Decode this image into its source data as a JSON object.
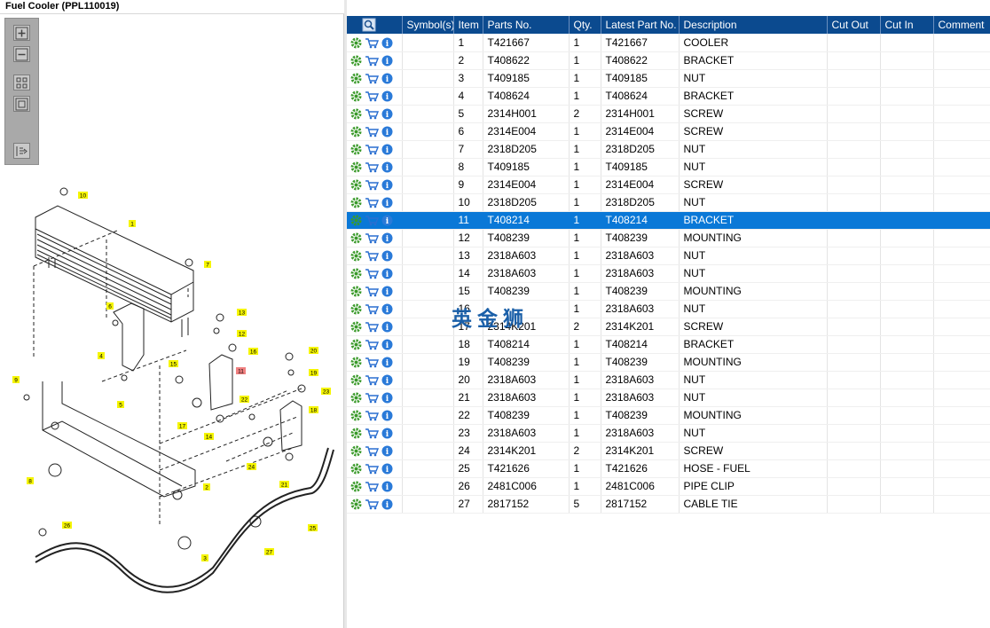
{
  "title": "Fuel Cooler (PPL110019)",
  "watermark": "英金狮",
  "toolbar": {
    "zoom_in": "zoom-in-icon",
    "zoom_out": "zoom-out-icon",
    "fit_all": "fit-all-icon",
    "fit_selection": "fit-selection-icon",
    "export": "export-icon"
  },
  "grid": {
    "columns": [
      "",
      "Symbol(s)",
      "Item",
      "Parts No.",
      "Qty.",
      "Latest Part No.",
      "Description",
      "Cut Out",
      "Cut In",
      "Comment"
    ],
    "selected_item": "11",
    "rows": [
      {
        "item": "1",
        "part": "T421667",
        "qty": "1",
        "latest": "T421667",
        "desc": "COOLER"
      },
      {
        "item": "2",
        "part": "T408622",
        "qty": "1",
        "latest": "T408622",
        "desc": "BRACKET"
      },
      {
        "item": "3",
        "part": "T409185",
        "qty": "1",
        "latest": "T409185",
        "desc": "NUT"
      },
      {
        "item": "4",
        "part": "T408624",
        "qty": "1",
        "latest": "T408624",
        "desc": "BRACKET"
      },
      {
        "item": "5",
        "part": "2314H001",
        "qty": "2",
        "latest": "2314H001",
        "desc": "SCREW"
      },
      {
        "item": "6",
        "part": "2314E004",
        "qty": "1",
        "latest": "2314E004",
        "desc": "SCREW"
      },
      {
        "item": "7",
        "part": "2318D205",
        "qty": "1",
        "latest": "2318D205",
        "desc": "NUT"
      },
      {
        "item": "8",
        "part": "T409185",
        "qty": "1",
        "latest": "T409185",
        "desc": "NUT"
      },
      {
        "item": "9",
        "part": "2314E004",
        "qty": "1",
        "latest": "2314E004",
        "desc": "SCREW"
      },
      {
        "item": "10",
        "part": "2318D205",
        "qty": "1",
        "latest": "2318D205",
        "desc": "NUT"
      },
      {
        "item": "11",
        "part": "T408214",
        "qty": "1",
        "latest": "T408214",
        "desc": "BRACKET"
      },
      {
        "item": "12",
        "part": "T408239",
        "qty": "1",
        "latest": "T408239",
        "desc": "MOUNTING"
      },
      {
        "item": "13",
        "part": "2318A603",
        "qty": "1",
        "latest": "2318A603",
        "desc": "NUT"
      },
      {
        "item": "14",
        "part": "2318A603",
        "qty": "1",
        "latest": "2318A603",
        "desc": "NUT"
      },
      {
        "item": "15",
        "part": "T408239",
        "qty": "1",
        "latest": "T408239",
        "desc": "MOUNTING"
      },
      {
        "item": "16",
        "part": "",
        "qty": "1",
        "latest": "2318A603",
        "desc": "NUT"
      },
      {
        "item": "17",
        "part": "2314K201",
        "qty": "2",
        "latest": "2314K201",
        "desc": "SCREW"
      },
      {
        "item": "18",
        "part": "T408214",
        "qty": "1",
        "latest": "T408214",
        "desc": "BRACKET"
      },
      {
        "item": "19",
        "part": "T408239",
        "qty": "1",
        "latest": "T408239",
        "desc": "MOUNTING"
      },
      {
        "item": "20",
        "part": "2318A603",
        "qty": "1",
        "latest": "2318A603",
        "desc": "NUT"
      },
      {
        "item": "21",
        "part": "2318A603",
        "qty": "1",
        "latest": "2318A603",
        "desc": "NUT"
      },
      {
        "item": "22",
        "part": "T408239",
        "qty": "1",
        "latest": "T408239",
        "desc": "MOUNTING"
      },
      {
        "item": "23",
        "part": "2318A603",
        "qty": "1",
        "latest": "2318A603",
        "desc": "NUT"
      },
      {
        "item": "24",
        "part": "2314K201",
        "qty": "2",
        "latest": "2314K201",
        "desc": "SCREW"
      },
      {
        "item": "25",
        "part": "T421626",
        "qty": "1",
        "latest": "T421626",
        "desc": "HOSE - FUEL"
      },
      {
        "item": "26",
        "part": "2481C006",
        "qty": "1",
        "latest": "2481C006",
        "desc": "PIPE CLIP"
      },
      {
        "item": "27",
        "part": "2817152",
        "qty": "5",
        "latest": "2817152",
        "desc": "CABLE TIE"
      }
    ]
  },
  "callouts": [
    "1",
    "2",
    "3",
    "4",
    "5",
    "6",
    "7",
    "8",
    "9",
    "10",
    "11",
    "12",
    "13",
    "14",
    "15",
    "16",
    "17",
    "18",
    "19",
    "20",
    "21",
    "22",
    "23",
    "24",
    "25",
    "26",
    "27"
  ],
  "colors": {
    "header": "#0b4a8f",
    "selected": "#0a78d7",
    "callout": "#f5f500",
    "callout_selected": "#f08080",
    "gear": "#3a9a2a",
    "cart": "#2a6fd0",
    "info": "#2a7ad8"
  }
}
